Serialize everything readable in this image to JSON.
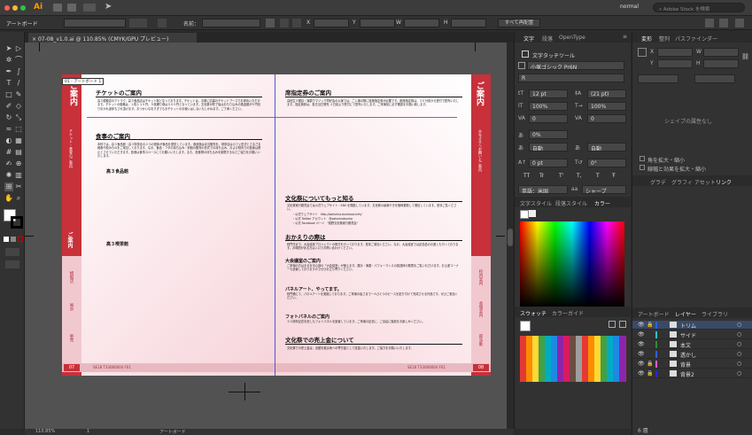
{
  "app": {
    "logo": "Ai",
    "workspace": "normal",
    "search_placeholder": "Adobe Stock を検索"
  },
  "control": {
    "label": "アートボード",
    "name_label": "名前：",
    "x_label": "X",
    "y_label": "Y",
    "w_label": "W",
    "h_label": "H",
    "all_button": "すべて再配置"
  },
  "document": {
    "tab_title": "07-08_v1.0.ai @ 110.85% (CMYK/GPU プレビュー)",
    "artboard_label": "01 - アートボード 1"
  },
  "status": {
    "zoom": "110.85%",
    "page": "1",
    "tool": "アートボード"
  },
  "left_page": {
    "band_title": "ご案内",
    "band_sub": "チケット・食堂のご案内",
    "band_small": "ご案内",
    "side_labels": [
      "模擬店",
      "展示",
      "販売"
    ],
    "h_tickets": "チケットのご案内",
    "p_tickets": "高３模擬店のアトラク、高３食品店はチケット制となっております。チケットは、お祭に応募のチケットブースでお求めいただけます。チケットの価格は、１枚１１０円、５枚綴り券は５００円となっています。文化祭が終了後はおもり込みの換金額が十円割り引かれ返却もされ頂けます。おつかいなをすぎてもおチケットのお使いはしないたしかねます。ご了承ください。",
    "h_food": "食事のご案内",
    "p_food": "本校では、高３食品館・高３喫茶店の２つの団体が食品を提供しています。食品館は弁当販売を、喫茶店はカフェ形式とさまざま軽食や飲みものをご用意しております。なお、食品・フタの持ち込み・別個の販売の形式での持ち込み、および校内での飲食は禁止とさせていただきます。飲食は食事スペースにてお願いいたします。また、飲食物の持ち込みを制限するなどご協力をお願いいたします。",
    "sub1": "高３食品館",
    "sub2": "高３喫茶館",
    "footer_num": "07",
    "footer_code": "SE18 T33060604 F01"
  },
  "right_page": {
    "band_title": "ご案内",
    "band_sub": "みなさまへお願いとご案内",
    "side_labels": [
      "校内案内",
      "会場案内",
      "部活動"
    ],
    "h_ticket_sale": "席指定券のご案内",
    "p_ticket_sale": "高校生３種目・演劇でマジック同好会の公演では、ご入場の際に座席指定券が必要です。座席指定券は、２０分前から受付で配布いたします。指定席券は、各日当日発売 ２日前より受付にて配布いたします。ご来場前に必ず確認をお願い致します。",
    "h_info": "文化祭についてもっと知る",
    "p_info": "文化祭実行委員会では公式ウェブサイト・SNS を開設しています。文化祭の最新やきを随時更新して発信しています。是非ご覧ください。",
    "links": [
      "・公式ウェブサイト　http://sakurino.bunkasai.info/",
      "・公式 Twitter アカウント　@sakurinobunka",
      "・公式 Facebook ページ　\"桜野文化祭実行委員会\""
    ],
    "h_return": "おかえりの際は",
    "p_return": "校門付近で、大会議室プロジェクトの受付を行っております。是非ご参加ください。なお、大会議室では記念品のお渡しも行っております。お時間がある方は入口でお問い合わせください。",
    "h_hall": "大会議室のご案内",
    "p_hall": "ご来場の方はまるを中心部の「大会議室」が使えます。展示・演劇・パフォーマンスの各団体の発表をご覧いただけます。お土産コーナーも設置しておりますのでぜひお立ち寄りください。",
    "h_parade": "パネルアート、やってます。",
    "p_parade": "校門横にて、パネルアートを実施しております。ご来場の皆さまで一人ひとつのピースを貼り付けて完成させる作品です。ぜひご参加ください。",
    "h_photo": "フォトパネルのご案内",
    "p_photo": "５０周年記念を祝したフォトパネルを設置しています。ご来場の記念に、ご自由に撮影をお楽しみください。",
    "h_sales": "文化祭での売上金について",
    "p_sales": "文化祭での売上金は、全額を被災地への寄付金として送金いたします。ご協力をお願いいたします。",
    "footer_num": "08",
    "footer_code": "SE18 T33060604 F01"
  },
  "char_panel": {
    "tabs": [
      "文字",
      "段落",
      "OpenType"
    ],
    "touch_tool": "文字タッチツール",
    "font_family": "小塚ゴシック Pr6N",
    "font_style": "R",
    "size": "12 pt",
    "leading": "(21 pt)",
    "vscale": "100%",
    "hscale": "100%",
    "kern": "0",
    "track": "0",
    "tsume": "0%",
    "aki1": "自動",
    "aki2": "自動",
    "baseline": "0 pt",
    "rotate": "0°",
    "tt_row": [
      "TT",
      "Tr",
      "T'",
      "T,",
      "T",
      "Ŧ"
    ],
    "lang": "英語：米国",
    "aa": "シャープ"
  },
  "style_tabs": [
    "文字スタイル",
    "段落スタイル",
    "カラー"
  ],
  "swatch_tabs": [
    "スウォッチ",
    "カラーガイド"
  ],
  "transform_panel": {
    "tabs": [
      "変形",
      "整列",
      "パスファインダー"
    ],
    "x": "X",
    "y": "Y",
    "w": "W",
    "h": "H",
    "note": "シェイプの属性なし",
    "check1": "角を拡大・縮小",
    "check2": "線幅と効果を拡大・縮小"
  },
  "link_tabs": [
    "グラデ",
    "グラフィ",
    "アセット",
    "リンク"
  ],
  "layers_panel": {
    "tabs": [
      "アートボード",
      "レイヤー",
      "ライブラリ"
    ],
    "layers": [
      {
        "name": "トリム",
        "color": "#2b62ff",
        "locked": true
      },
      {
        "name": "サイド",
        "color": "#31c3c3",
        "locked": false
      },
      {
        "name": "本文",
        "color": "#2f8f2f",
        "locked": false
      },
      {
        "name": "透かし",
        "color": "#2b62ff",
        "locked": false
      },
      {
        "name": "背景",
        "color": "#ff5ac8",
        "locked": true
      },
      {
        "name": "背景2",
        "color": "#2a2ac8",
        "locked": true
      }
    ],
    "count": "6 層"
  },
  "colors": {
    "accent": "#c8303a",
    "pink": "#f2c8cf"
  }
}
